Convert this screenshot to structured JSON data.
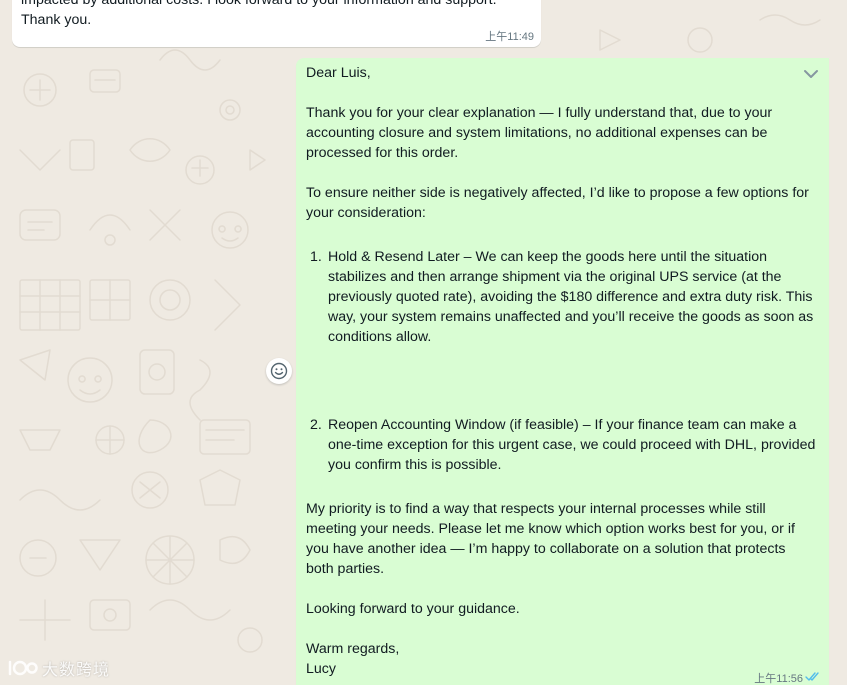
{
  "chat": {
    "incoming": {
      "lines": [
        "impacted by additional costs. I look forward to your information and support.",
        "Thank you."
      ],
      "time": "上午11:49"
    },
    "outgoing": {
      "greeting": "Dear Luis,",
      "paragraph1": [
        "Thank you for your clear explanation — I fully understand that, due to your",
        "accounting closure and system limitations, no additional expenses can be",
        "processed for this order."
      ],
      "paragraph2": [
        "To ensure neither side is negatively affected, I’d like to propose a few options for",
        "your consideration:"
      ],
      "option1": {
        "number": "1.",
        "lines": [
          "Hold & Resend Later – We can keep the goods here until the situation",
          "stabilizes and then arrange shipment via the original UPS service (at the",
          "previously quoted rate), avoiding the $180 difference and extra duty risk. This",
          "way, your system remains unaffected and you’ll receive the goods as soon as",
          "conditions allow."
        ]
      },
      "option2": {
        "number": "2.",
        "lines": [
          "Reopen Accounting Window (if feasible) – If your finance team can make a",
          "one-time exception for this urgent case, we could proceed with DHL, provided",
          "you confirm this is possible."
        ]
      },
      "paragraph3": [
        "My priority is to find a way that respects your internal processes while still",
        "meeting your needs. Please let me know which option works best for you, or if",
        "you have another idea — I’m happy to collaborate on a solution that protects",
        "both parties."
      ],
      "closing": "Looking forward to your guidance.",
      "signoff": "Warm regards,",
      "signature": "Lucy",
      "time": "上午11:56",
      "status_icon": "double-check-read-icon"
    }
  },
  "watermark": {
    "text": "大数跨境"
  },
  "colors": {
    "background": "#efeae2",
    "outgoing_bubble": "#d9fdd3",
    "incoming_bubble": "#ffffff",
    "read_ticks": "#53bdeb"
  }
}
